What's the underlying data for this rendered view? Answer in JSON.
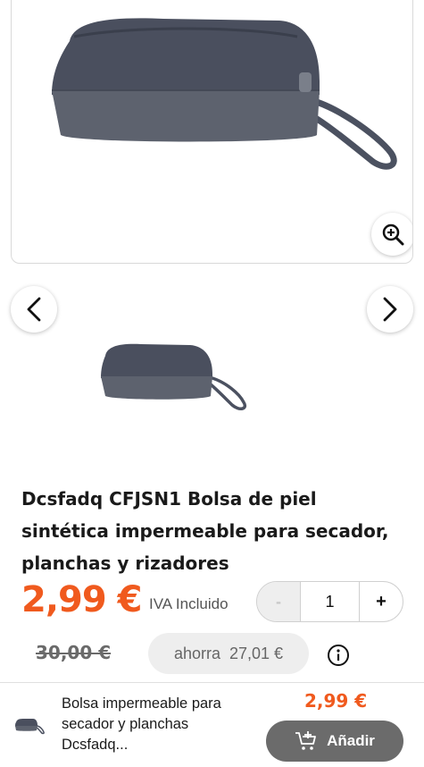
{
  "product": {
    "title": "Dcsfadq CFJSN1 Bolsa de piel sintética impermeable para secador, planchas y rizadores",
    "price": "2,99 €",
    "tax_note": "IVA Incluido",
    "old_price": "30,00 €",
    "savings_label": "ahorra",
    "savings_amount": "27,01 €"
  },
  "gallery": {
    "zoom_icon": "zoom-in-icon",
    "prev_icon": "chevron-left-icon",
    "next_icon": "chevron-right-icon"
  },
  "quantity": {
    "minus_label": "-",
    "value": "1",
    "plus_label": "+"
  },
  "bottom_bar": {
    "name": "Bolsa impermeable para secador y planchas Dcsfadq...",
    "price": "2,99 €",
    "add_label": "Añadir",
    "cart_icon": "cart-plus-icon"
  },
  "colors": {
    "accent": "#f05a1e",
    "button_bg": "#6b6b6b",
    "pill_bg": "#eeeeee"
  }
}
